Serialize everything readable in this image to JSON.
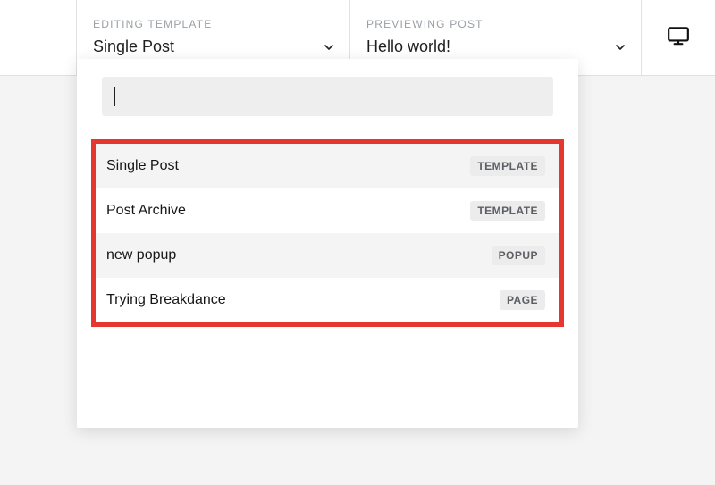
{
  "header": {
    "editing": {
      "label": "EDITING TEMPLATE",
      "value": "Single Post"
    },
    "previewing": {
      "label": "PREVIEWING POST",
      "value": "Hello world!"
    }
  },
  "search": {
    "placeholder": "",
    "value": ""
  },
  "dropdown": {
    "items": [
      {
        "label": "Single Post",
        "badge": "TEMPLATE"
      },
      {
        "label": "Post Archive",
        "badge": "TEMPLATE"
      },
      {
        "label": "new popup",
        "badge": "POPUP"
      },
      {
        "label": "Trying Breakdance",
        "badge": "PAGE"
      }
    ]
  },
  "icons": {
    "chevron_down": "chevron-down-icon",
    "device": "monitor-icon"
  },
  "colors": {
    "highlight_border": "#e5362f",
    "badge_bg": "#ececec",
    "panel_label": "#9aa0a5"
  }
}
